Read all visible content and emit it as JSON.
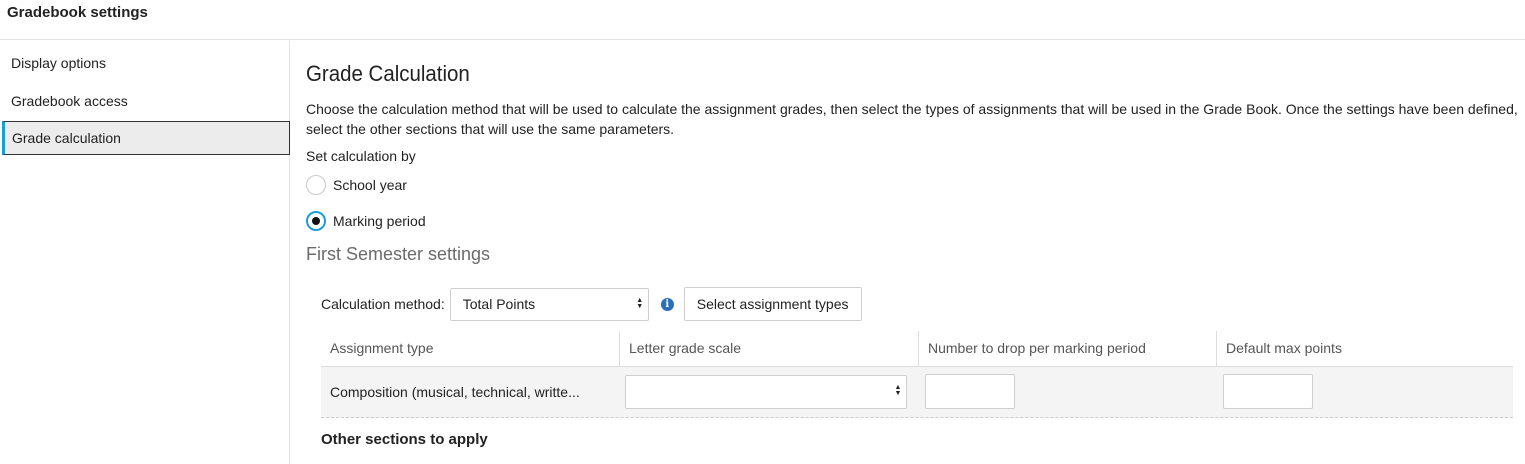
{
  "header": {
    "title": "Gradebook settings"
  },
  "sidebar": {
    "items": [
      {
        "label": "Display options",
        "active": false
      },
      {
        "label": "Gradebook access",
        "active": false
      },
      {
        "label": "Grade calculation",
        "active": true
      }
    ]
  },
  "main": {
    "heading": "Grade Calculation",
    "description": "Choose the calculation method that will be used to calculate the assignment grades, then select the types of assignments that will be used in the Grade Book. Once the settings have been defined, select the other sections that will use the same parameters.",
    "set_by_label": "Set calculation by",
    "radios": [
      {
        "label": "School year",
        "checked": false
      },
      {
        "label": "Marking period",
        "checked": true
      }
    ],
    "semester_heading": "First Semester settings",
    "calc_method_label": "Calculation method:",
    "calc_method_value": "Total Points",
    "select_types_button": "Select assignment types",
    "table": {
      "columns": [
        "Assignment type",
        "Letter grade scale",
        "Number to drop per marking period",
        "Default max points"
      ],
      "rows": [
        {
          "assignment_type": "Composition (musical, technical, writte...",
          "letter_grade_scale": "",
          "number_to_drop": "",
          "default_max_points": ""
        }
      ]
    },
    "other_sections_label": "Other sections to apply"
  },
  "colors": {
    "accent": "#1a9fd9",
    "info_icon": "#2a6fb5"
  }
}
